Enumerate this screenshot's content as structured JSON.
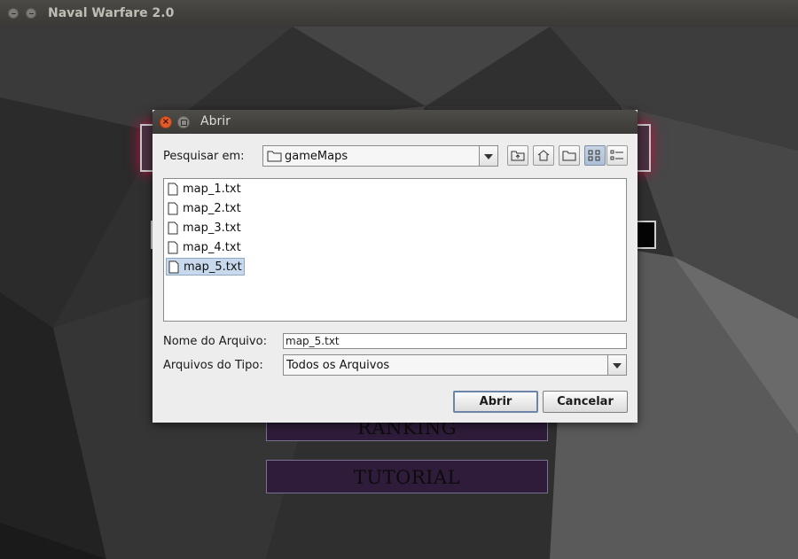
{
  "window": {
    "title": "Naval Warfare 2.0"
  },
  "game": {
    "ranking_label": "RANKING",
    "tutorial_label": "TUTORIAL"
  },
  "dialog": {
    "title": "Abrir",
    "look_in_label": "Pesquisar em:",
    "look_in_value": "gameMaps",
    "files": [
      {
        "name": "map_1.txt",
        "selected": false
      },
      {
        "name": "map_2.txt",
        "selected": false
      },
      {
        "name": "map_3.txt",
        "selected": false
      },
      {
        "name": "map_4.txt",
        "selected": false
      },
      {
        "name": "map_5.txt",
        "selected": true
      }
    ],
    "filename_label": "Nome do Arquivo:",
    "filename_value": "map_5.txt",
    "filetype_label": "Arquivos do Tipo:",
    "filetype_value": "Todos os Arquivos",
    "open_button": "Abrir",
    "cancel_button": "Cancelar",
    "toolbar_icons": [
      "up-folder-icon",
      "home-icon",
      "new-folder-icon",
      "list-view-icon",
      "details-view-icon"
    ]
  },
  "colors": {
    "selection": "#c8d9ee",
    "game_button": "#2e1c3a",
    "banner_glow": "#c01040"
  }
}
